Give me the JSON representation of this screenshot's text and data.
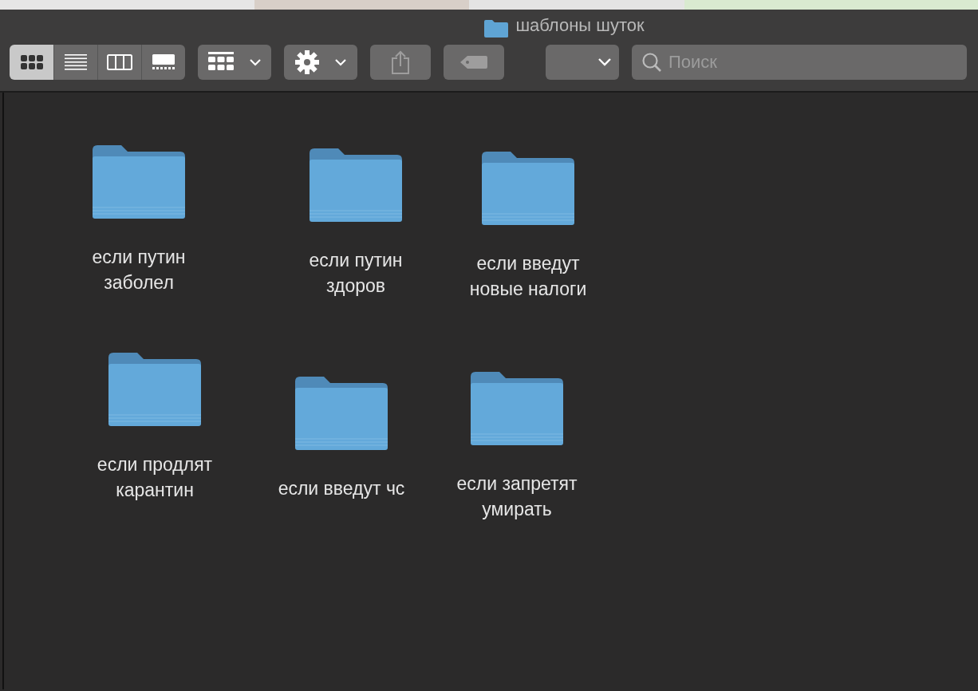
{
  "window": {
    "title": "шаблоны шуток"
  },
  "toolbar": {
    "view_modes": [
      {
        "kind": "icons",
        "selected": true
      },
      {
        "kind": "list",
        "selected": false
      },
      {
        "kind": "columns",
        "selected": false
      },
      {
        "kind": "gallery",
        "selected": false
      }
    ],
    "share": {
      "disabled": true
    },
    "tags": {
      "disabled": true
    }
  },
  "search": {
    "placeholder": "Поиск"
  },
  "folders": [
    [
      {
        "name": "если путин заболел"
      },
      {
        "name": "если путин здоров"
      },
      {
        "name": "если введут новые налоги"
      }
    ],
    [
      {
        "name": "если продлят карантин"
      },
      {
        "name": "если введут чс"
      },
      {
        "name": "если запретят умирать"
      }
    ]
  ]
}
